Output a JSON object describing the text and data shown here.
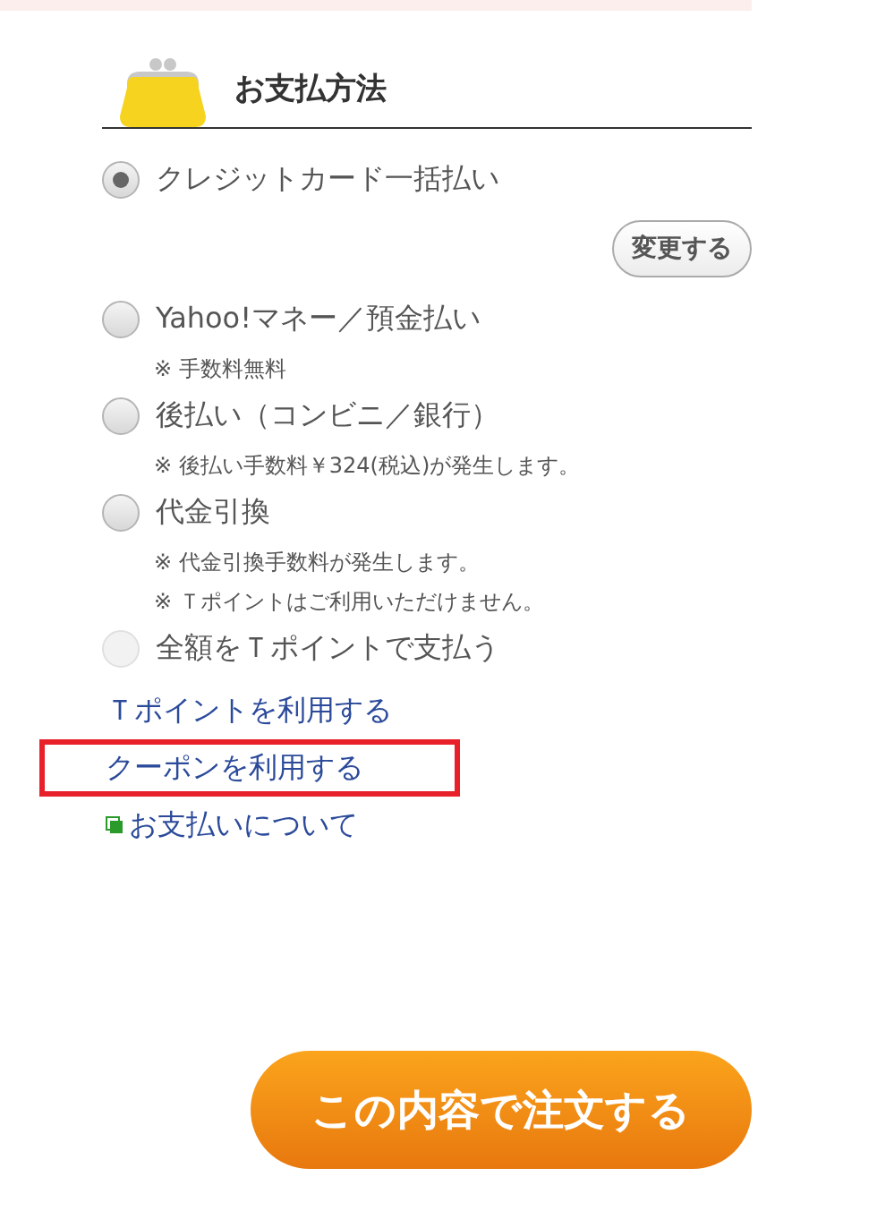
{
  "section": {
    "title": "お支払方法"
  },
  "methods": [
    {
      "label": "クレジットカード一括払い",
      "selected": true,
      "disabled": false,
      "action": "変更する"
    },
    {
      "label": "Yahoo!マネー／預金払い",
      "selected": false,
      "disabled": false,
      "notes": [
        "※ 手数料無料"
      ]
    },
    {
      "label": "後払い（コンビニ／銀行）",
      "selected": false,
      "disabled": false,
      "notes": [
        "※ 後払い手数料￥324(税込)が発生します。"
      ]
    },
    {
      "label": "代金引換",
      "selected": false,
      "disabled": false,
      "notes": [
        "※ 代金引換手数料が発生します。",
        "※ Ｔポイントはご利用いただけません。"
      ]
    },
    {
      "label": "全額をＴポイントで支払う",
      "selected": false,
      "disabled": true
    }
  ],
  "links": [
    {
      "kind": "link",
      "text": "Ｔポイントを利用する",
      "highlighted": false
    },
    {
      "kind": "link",
      "text": "クーポンを利用する",
      "highlighted": true
    },
    {
      "kind": "help",
      "text": "お支払いについて",
      "highlighted": false
    }
  ],
  "order_button": "この内容で注文する"
}
